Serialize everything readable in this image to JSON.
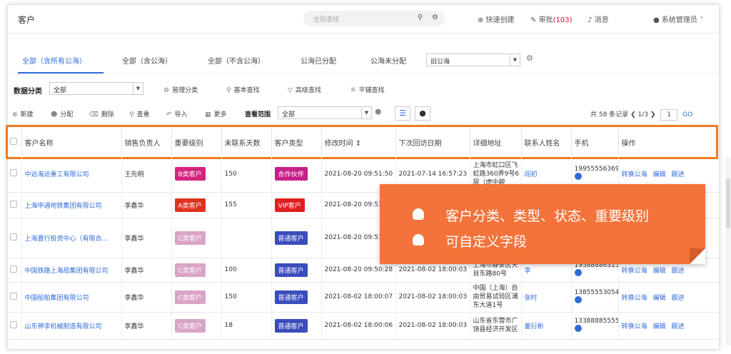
{
  "header": {
    "title": "客户",
    "search_placeholder": "全局查找",
    "quick_create": "快速创建",
    "approve": "审批",
    "approve_count": "(103)",
    "message": "消息",
    "user": "系统管理员"
  },
  "tabs": [
    "全部（含所有公海）",
    "全部（含公海）",
    "全部（不含公海）",
    "公海已分配",
    "公海未分配"
  ],
  "pool_select": "旧公海",
  "filter": {
    "label": "数据分类",
    "value": "全部",
    "manage": "管理分类",
    "basic": "基本查找",
    "advanced": "高级查找",
    "tile": "平铺查找"
  },
  "toolbar": {
    "new": "新建",
    "assign": "分配",
    "delete": "删除",
    "dup": "查重",
    "import": "导入",
    "more": "更多",
    "scope_label": "查看范围",
    "scope_value": "全部"
  },
  "pager": {
    "total": "共 58 条记录",
    "page": "1/3",
    "input": "1",
    "go": "GO"
  },
  "columns": [
    "客户名称",
    "销售负责人",
    "重要级别",
    "未联系天数",
    "客户类型",
    "修改时间",
    "下次回访日期",
    "详细地址",
    "联系人姓名",
    "手机",
    "操作"
  ],
  "rows": [
    {
      "name": "中远海运重工有限公司",
      "owner": "王先明",
      "level": "B类客户",
      "lv": "b",
      "days": "150",
      "type": "合作伙伴",
      "tp": "coop",
      "mod": "2021-08-20 09:51:50",
      "next": "2021-07-14 16:57:23",
      "addr": "上海市虹口区飞虹路360弄9号6层（虎中碧",
      "contact": "阎初",
      "phone": "19955556369"
    },
    {
      "name": "上海申通地铁集团有限公司",
      "owner": "李鑫华",
      "level": "A类客户",
      "lv": "a",
      "days": "155",
      "type": "VIP客户",
      "tp": "vip",
      "mod": "2021-08-20 09:51",
      "next": "",
      "addr": "",
      "contact": "",
      "phone": ""
    },
    {
      "name": "上海置行投资中心（有限合...",
      "owner": "李鑫华",
      "level": "C类客户",
      "lv": "c",
      "days": "",
      "type": "普通客户",
      "tp": "norm",
      "mod": "2021-08-20 09:51",
      "next": "",
      "addr": "",
      "contact": "",
      "phone": ""
    },
    {
      "name": "中国铁路上海局集团有限公司",
      "owner": "李鑫华",
      "level": "C类客户",
      "lv": "c",
      "days": "100",
      "type": "普通客户",
      "tp": "norm",
      "mod": "2021-08-20 09:50:28",
      "next": "2021-08-02 18:00:03",
      "addr": "上海市静安区天目东路80号",
      "contact": "李",
      "phone": "19588886315"
    },
    {
      "name": "中国船舶集团有限公司",
      "owner": "李鑫华",
      "level": "C类客户",
      "lv": "c",
      "days": "150",
      "type": "普通客户",
      "tp": "norm",
      "mod": "2021-08-02 18:00:07",
      "next": "2021-08-02 18:00:03",
      "addr": "中国（上海）自由贸易试验区浦东大道1号",
      "contact": "张时",
      "phone": "13855553054"
    },
    {
      "name": "山东神李机械制造有限公司",
      "owner": "李鑫华",
      "level": "C类客户",
      "lv": "c",
      "days": "18",
      "type": "普通客户",
      "tp": "norm",
      "mod": "2021-08-02 18:00:06",
      "next": "2021-08-02 18:00:03",
      "addr": "山东省东营市广饶县经济开发区",
      "contact": "董衍彬",
      "phone": "13388885555"
    }
  ],
  "ops": [
    "转换公海",
    "编辑",
    "跟进"
  ],
  "popup": {
    "line1": "客户分类、类型、状态、重要级别",
    "line2": "可自定义字段"
  }
}
